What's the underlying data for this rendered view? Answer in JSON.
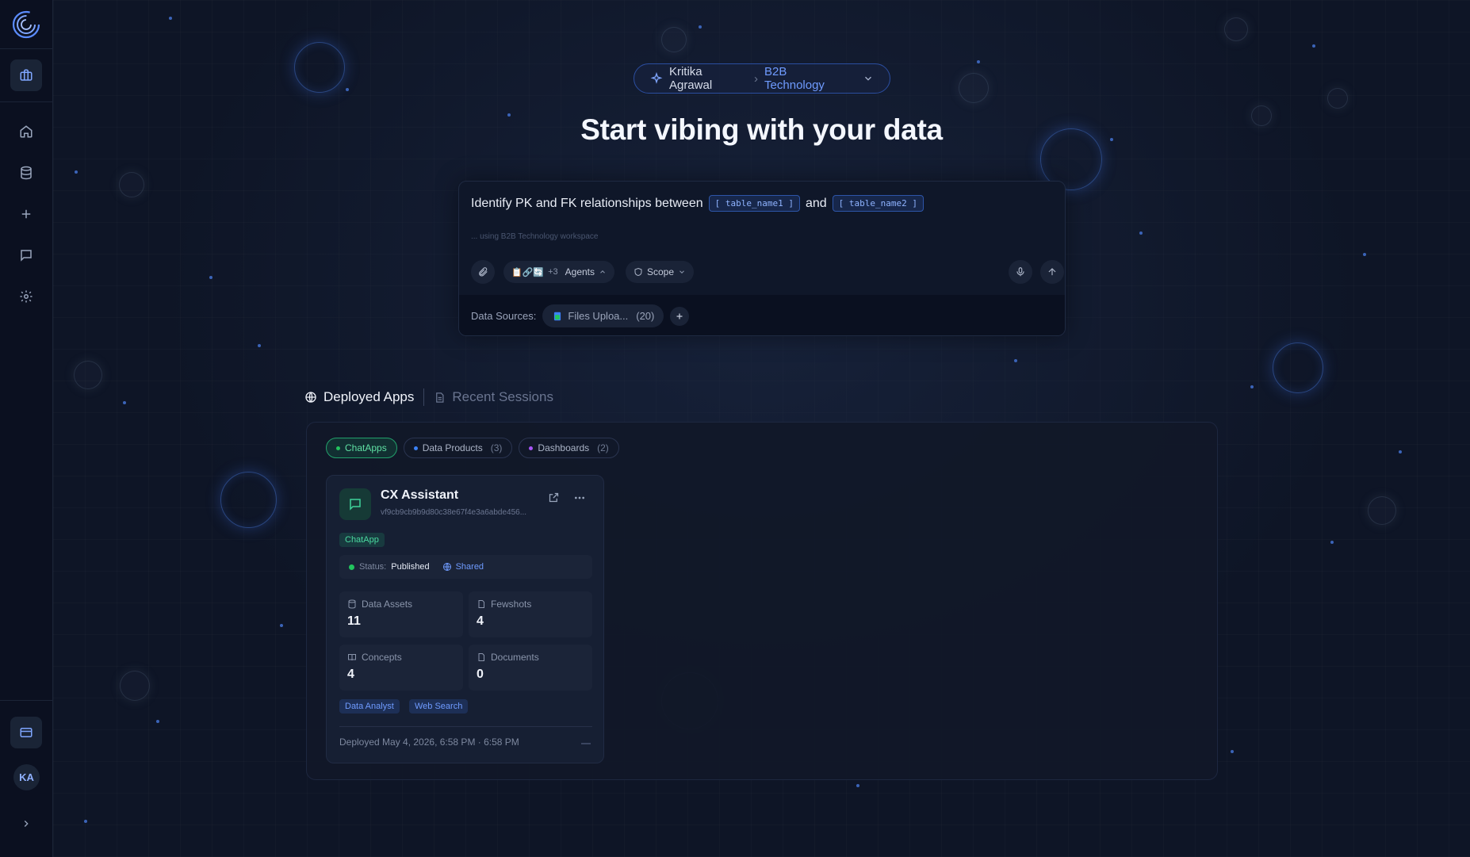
{
  "sidebar": {
    "logo": "logo-icon",
    "items": [
      {
        "name": "briefcase-icon",
        "active": true
      },
      {
        "name": "home-icon",
        "active": false
      },
      {
        "name": "database-icon",
        "active": false
      },
      {
        "name": "plus-icon",
        "active": false
      },
      {
        "name": "chat-icon",
        "active": false
      },
      {
        "name": "gear-icon",
        "active": false
      }
    ],
    "billing_icon": "card-icon",
    "avatar_initials": "KA",
    "expand_icon": "chevron-right-icon"
  },
  "breadcrumb": {
    "user": "Kritika Agrawal",
    "separator": "›",
    "workspace": "B2B Technology"
  },
  "hero_title": "Start vibing with your data",
  "prompt": {
    "text_before": "Identify PK and FK relationships between",
    "var1": "[ table_name1 ]",
    "text_mid": "and",
    "var2": "[ table_name2 ]",
    "hint": "... using B2B Technology workspace",
    "agents_emojis": "📋🔗🔄",
    "agents_more": "+3",
    "agents_label": "Agents",
    "scope_label": "Scope"
  },
  "data_sources": {
    "label": "Data Sources:",
    "chip_label": "Files Uploa...",
    "chip_count": "(20)"
  },
  "tabs": [
    {
      "label": "Deployed Apps",
      "active": true
    },
    {
      "label": "Recent Sessions",
      "active": false
    }
  ],
  "filters": [
    {
      "label": "ChatApps",
      "count": "",
      "color": "#22c55e",
      "active": true
    },
    {
      "label": "Data Products",
      "count": "(3)",
      "color": "#3b82f6",
      "active": false
    },
    {
      "label": "Dashboards",
      "count": "(2)",
      "color": "#a855f7",
      "active": false
    }
  ],
  "card": {
    "title": "CX Assistant",
    "id": "vf9cb9cb9b9d80c38e67f4e3a6abde456...",
    "type_badge": "ChatApp",
    "status_label": "Status:",
    "status_value": "Published",
    "shared_label": "Shared",
    "metrics": [
      {
        "label": "Data Assets",
        "value": "11"
      },
      {
        "label": "Fewshots",
        "value": "4"
      },
      {
        "label": "Concepts",
        "value": "4"
      },
      {
        "label": "Documents",
        "value": "0"
      }
    ],
    "tags": [
      "Data Analyst",
      "Web Search"
    ],
    "footer": "Deployed May 4, 2026, 6:58 PM · 6:58 PM"
  },
  "colors": {
    "accent": "#6f9bff",
    "success": "#22c55e",
    "background": "#0e1526"
  }
}
